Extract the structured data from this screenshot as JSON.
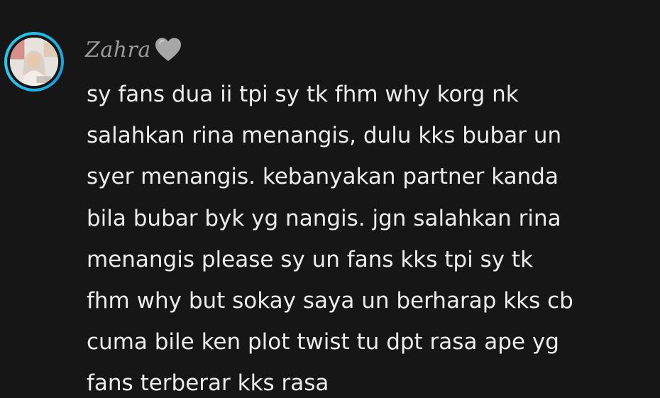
{
  "comment": {
    "username": "Zahra",
    "username_badge_icon": "grey-heart-icon",
    "avatar_ring_color": "#22c3e6",
    "lines": [
      "sy fans dua ii tpi sy tk fhm why korg nk",
      "salahkan rina menangis, dulu kks bubar un",
      "syer menangis. kebanyakan partner kanda",
      "bila bubar byk yg nangis. jgn salahkan rina",
      "menangis please sy un fans kks tpi sy tk",
      "fhm why but sokay saya un berharap kks cb",
      "cuma bile ken plot twist tu dpt rasa ape yg",
      "fans terberar kks rasa"
    ]
  }
}
